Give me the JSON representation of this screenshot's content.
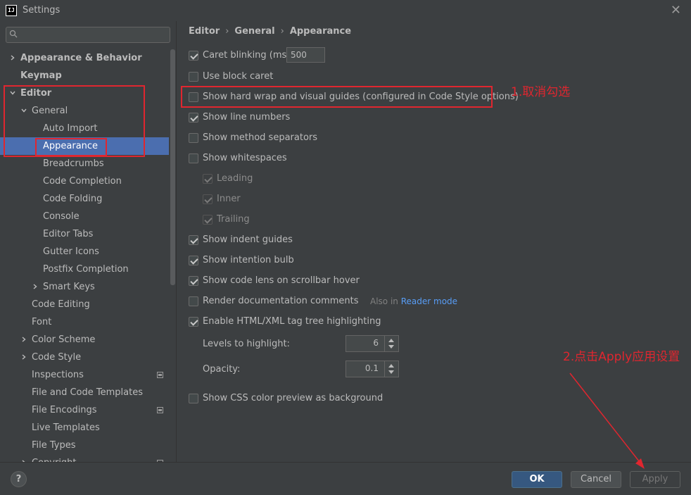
{
  "window": {
    "app_icon_text": "IJ",
    "title": "Settings",
    "close_glyph": "✕"
  },
  "search": {
    "placeholder": "",
    "value": ""
  },
  "sidebar": {
    "items": [
      {
        "label": "Appearance & Behavior",
        "bold": true,
        "arrow": "right"
      },
      {
        "label": "Keymap",
        "bold": true,
        "arrow": "none"
      },
      {
        "label": "Editor",
        "bold": true,
        "arrow": "down"
      },
      {
        "label": "General",
        "bold": false,
        "arrow": "down"
      },
      {
        "label": "Auto Import",
        "bold": false,
        "arrow": "none"
      },
      {
        "label": "Appearance",
        "bold": false,
        "arrow": "none",
        "selected": true
      },
      {
        "label": "Breadcrumbs",
        "bold": false,
        "arrow": "none"
      },
      {
        "label": "Code Completion",
        "bold": false,
        "arrow": "none"
      },
      {
        "label": "Code Folding",
        "bold": false,
        "arrow": "none"
      },
      {
        "label": "Console",
        "bold": false,
        "arrow": "none"
      },
      {
        "label": "Editor Tabs",
        "bold": false,
        "arrow": "none"
      },
      {
        "label": "Gutter Icons",
        "bold": false,
        "arrow": "none"
      },
      {
        "label": "Postfix Completion",
        "bold": false,
        "arrow": "none"
      },
      {
        "label": "Smart Keys",
        "bold": false,
        "arrow": "right"
      },
      {
        "label": "Code Editing",
        "bold": false,
        "arrow": "none"
      },
      {
        "label": "Font",
        "bold": false,
        "arrow": "none"
      },
      {
        "label": "Color Scheme",
        "bold": false,
        "arrow": "right"
      },
      {
        "label": "Code Style",
        "bold": false,
        "arrow": "right"
      },
      {
        "label": "Inspections",
        "bold": false,
        "arrow": "none",
        "project_icon": true
      },
      {
        "label": "File and Code Templates",
        "bold": false,
        "arrow": "none"
      },
      {
        "label": "File Encodings",
        "bold": false,
        "arrow": "none",
        "project_icon": true
      },
      {
        "label": "Live Templates",
        "bold": false,
        "arrow": "none"
      },
      {
        "label": "File Types",
        "bold": false,
        "arrow": "none"
      },
      {
        "label": "Copyright",
        "bold": false,
        "arrow": "right",
        "project_icon": true
      }
    ]
  },
  "breadcrumb": {
    "parts": [
      "Editor",
      "General",
      "Appearance"
    ],
    "separator": "›"
  },
  "options": {
    "caret_blinking": {
      "label": "Caret blinking (ms):",
      "checked": true,
      "value": "500"
    },
    "block_caret": {
      "label": "Use block caret",
      "checked": false
    },
    "hard_wrap": {
      "label": "Show hard wrap and visual guides (configured in Code Style options)",
      "checked": false
    },
    "line_numbers": {
      "label": "Show line numbers",
      "checked": true
    },
    "method_separators": {
      "label": "Show method separators",
      "checked": false
    },
    "whitespaces": {
      "label": "Show whitespaces",
      "checked": false
    },
    "leading": {
      "label": "Leading",
      "checked": true,
      "disabled": true
    },
    "inner": {
      "label": "Inner",
      "checked": true,
      "disabled": true
    },
    "trailing": {
      "label": "Trailing",
      "checked": true,
      "disabled": true
    },
    "indent_guides": {
      "label": "Show indent guides",
      "checked": true
    },
    "intention_bulb": {
      "label": "Show intention bulb",
      "checked": true
    },
    "code_lens": {
      "label": "Show code lens on scrollbar hover",
      "checked": true
    },
    "render_docs": {
      "label": "Render documentation comments",
      "checked": false,
      "also_in_prefix": "Also in ",
      "also_in_link": "Reader mode"
    },
    "tag_tree": {
      "label": "Enable HTML/XML tag tree highlighting",
      "checked": true
    },
    "levels": {
      "label": "Levels to highlight:",
      "value": "6"
    },
    "opacity": {
      "label": "Opacity:",
      "value": "0.1"
    },
    "css_color": {
      "label": "Show CSS color preview as background",
      "checked": false
    }
  },
  "annotations": {
    "step1": "1.取消勾选",
    "step2": "2.点击Apply应用设置",
    "color": "#e0262f"
  },
  "footer": {
    "help": "?",
    "ok": "OK",
    "cancel": "Cancel",
    "apply": "Apply"
  },
  "colors": {
    "background": "#3c3f41",
    "selection": "#4b6eaf",
    "link": "#589df6",
    "ok_button": "#365880"
  }
}
